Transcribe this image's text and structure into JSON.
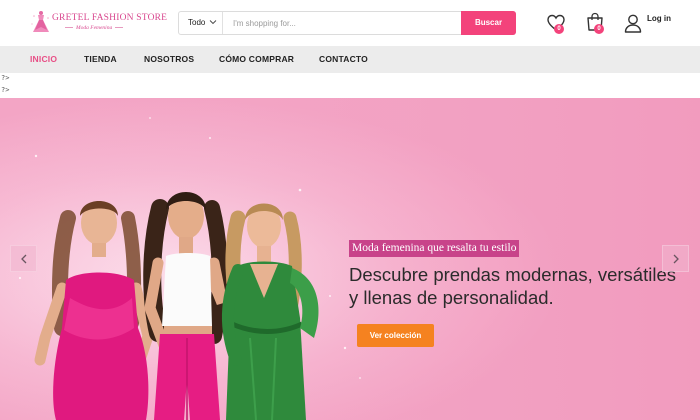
{
  "brand": {
    "name": "GRETEL FASHION STORE",
    "tagline": "Moda Femenina"
  },
  "search": {
    "category": "Todo",
    "placeholder": "I'm shopping for...",
    "button_label": "Buscar"
  },
  "header": {
    "wishlist_count": "0",
    "cart_count": "0",
    "login_label": "Log in"
  },
  "nav": {
    "items": [
      {
        "label": "INICIO",
        "active": true
      },
      {
        "label": "TIENDA",
        "active": false
      },
      {
        "label": "NOSOTROS",
        "active": false
      },
      {
        "label": "CÓMO COMPRAR",
        "active": false
      },
      {
        "label": "CONTACTO",
        "active": false
      }
    ]
  },
  "stray_output": [
    "?>",
    "?>"
  ],
  "hero": {
    "tagline": "Moda femenina que resalta tu estilo",
    "headline": "Descubre prendas modernas, versátiles y llenas de personalidad.",
    "cta_label": "Ver colección",
    "prev_icon": "chevron-left-icon",
    "next_icon": "chevron-right-icon"
  },
  "colors": {
    "accent": "#f3437b",
    "nav_active": "#e84f86",
    "hero_bg": "#f3a5c5",
    "tagline_bg": "#c8438a",
    "cta": "#f58220"
  }
}
